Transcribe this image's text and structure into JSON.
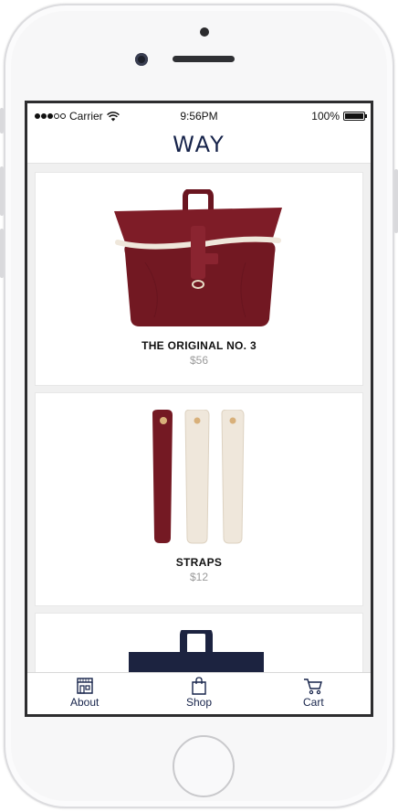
{
  "status_bar": {
    "carrier": "Carrier",
    "time": "9:56PM",
    "battery": "100%",
    "battery_level": 1.0
  },
  "header": {
    "title": "WAY"
  },
  "products": [
    {
      "name": "THE ORIGINAL NO. 3",
      "price": "$56",
      "color": "#7a1a24"
    },
    {
      "name": "STRAPS",
      "price": "$12",
      "color": "#7a1a24"
    },
    {
      "name": "",
      "price": "",
      "color": "#1c2340"
    }
  ],
  "tabs": [
    {
      "label": "About",
      "icon": "storefront-icon"
    },
    {
      "label": "Shop",
      "icon": "shopping-bag-icon"
    },
    {
      "label": "Cart",
      "icon": "cart-icon"
    }
  ],
  "colors": {
    "brand_navy": "#16234a",
    "burgundy": "#7a1a24",
    "cream": "#efe7db"
  }
}
